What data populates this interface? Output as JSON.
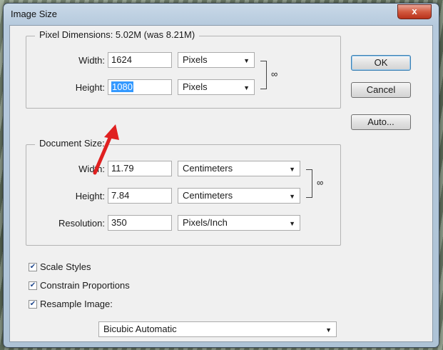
{
  "window": {
    "title": "Image Size",
    "close_glyph": "x"
  },
  "pixel_dimensions": {
    "title": "Pixel Dimensions:  5.02M (was 8.21M)",
    "width_label": "Width:",
    "width_value": "1624",
    "width_unit": "Pixels",
    "height_label": "Height:",
    "height_value": "1080",
    "height_unit": "Pixels"
  },
  "document_size": {
    "title": "Document Size:",
    "width_label": "Width:",
    "width_value": "11.79",
    "width_unit": "Centimeters",
    "height_label": "Height:",
    "height_value": "7.84",
    "height_unit": "Centimeters",
    "resolution_label": "Resolution:",
    "resolution_value": "350",
    "resolution_unit": "Pixels/Inch"
  },
  "buttons": {
    "ok": "OK",
    "cancel": "Cancel",
    "auto": "Auto..."
  },
  "options": {
    "scale_styles": {
      "label": "Scale Styles",
      "checked": true
    },
    "constrain_proportions": {
      "label": "Constrain Proportions",
      "checked": true
    },
    "resample_image": {
      "label": "Resample Image:",
      "checked": true
    }
  },
  "resample_method": "Bicubic Automatic",
  "icons": {
    "dropdown": "chevron-down-icon",
    "link": "chain-link-icon",
    "annotation": "red-arrow-annotation-icon"
  },
  "colors": {
    "selection": "#3399ff",
    "annotation_arrow": "#e02020",
    "window_frame": "#b6cadd"
  }
}
